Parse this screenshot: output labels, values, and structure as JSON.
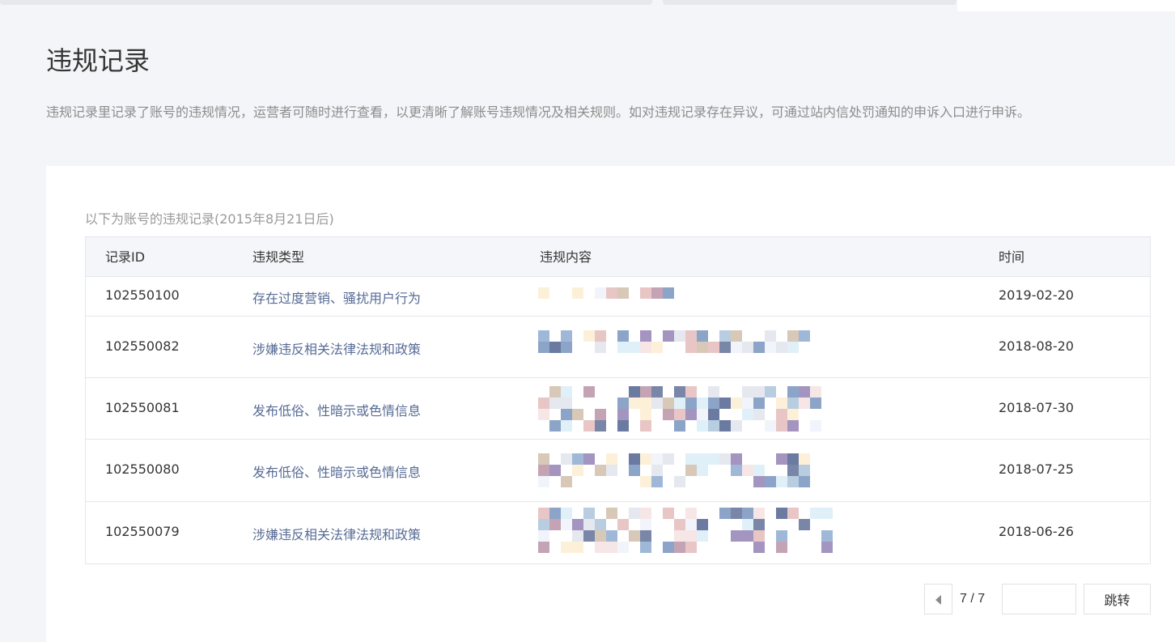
{
  "page": {
    "title": "违规记录",
    "description": "违规记录里记录了账号的违规情况，运营者可随时进行查看，以更清晰了解账号违规情况及相关规则。如对违规记录存在异议，可通过站内信处罚通知的申诉入口进行申诉。"
  },
  "records": {
    "subtitle": "以下为账号的违规记录(2015年8月21日后)",
    "columns": {
      "id": "记录ID",
      "type": "违规类型",
      "content": "违规内容",
      "time": "时间"
    },
    "rows": [
      {
        "id": "102550100",
        "type": "存在过度营销、骚扰用户行为",
        "time": "2019-02-20"
      },
      {
        "id": "102550082",
        "type": "涉嫌违反相关法律法规和政策",
        "time": "2018-08-20"
      },
      {
        "id": "102550081",
        "type": "发布低俗、性暗示或色情信息",
        "time": "2018-07-30"
      },
      {
        "id": "102550080",
        "type": "发布低俗、性暗示或色情信息",
        "time": "2018-07-25"
      },
      {
        "id": "102550079",
        "type": "涉嫌违反相关法律法规和政策",
        "time": "2018-06-26"
      }
    ]
  },
  "pagination": {
    "page_info": "7 / 7",
    "jump_value": "",
    "jump_label": "跳转"
  },
  "colors": {
    "link": "#576b95",
    "mosaic_palette": [
      "#7a86a8",
      "#e6e8f0",
      "#c4a4b4",
      "#e9c6c6",
      "#a494c0",
      "#b8cde0",
      "#8ca4c8",
      "#fdf0d8",
      "#f2f4fb",
      "#d8c8b8",
      "#f6e6e6",
      "#6b7aa0",
      "#e0f0f8",
      "#a0b8d8"
    ]
  }
}
